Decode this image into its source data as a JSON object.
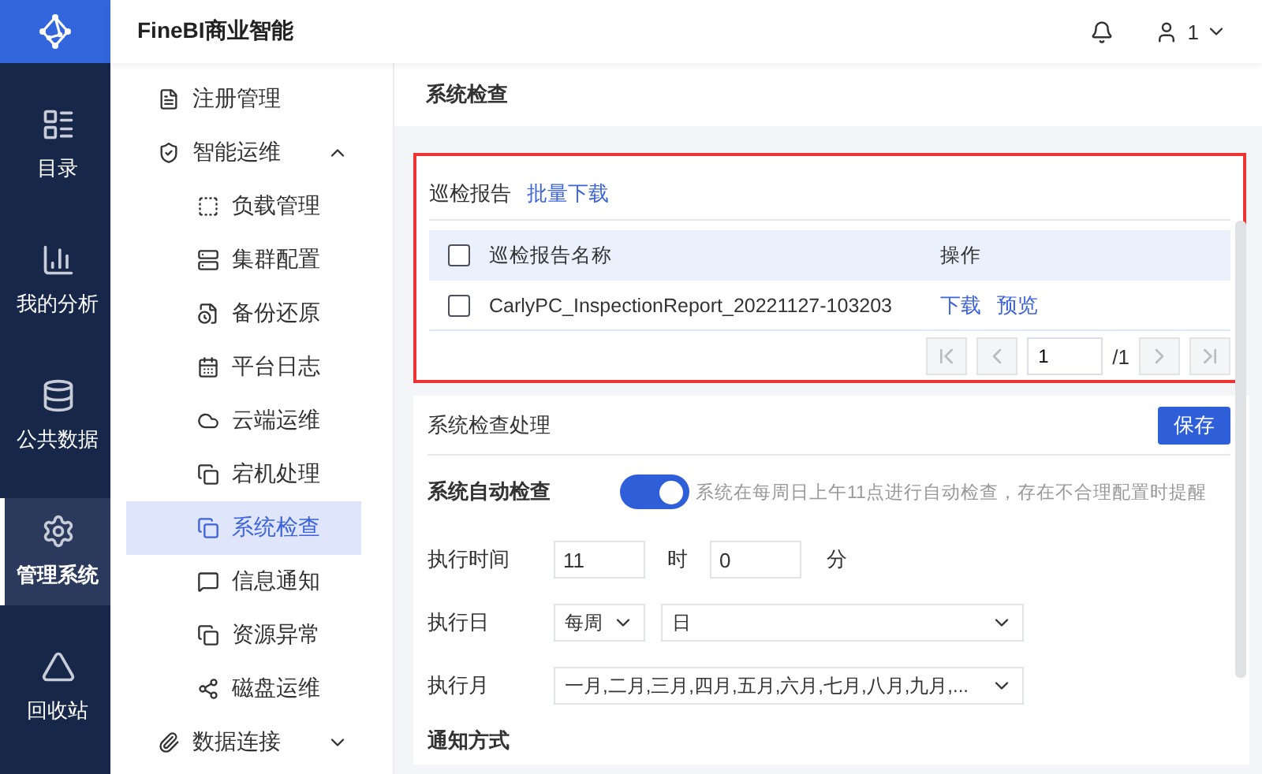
{
  "app": {
    "title": "FineBI商业智能"
  },
  "header": {
    "user": "1"
  },
  "nav": [
    {
      "label": "目录",
      "selected": false
    },
    {
      "label": "我的分析",
      "selected": false
    },
    {
      "label": "公共数据",
      "selected": false
    },
    {
      "label": "管理系统",
      "selected": true
    },
    {
      "label": "回收站",
      "selected": false
    }
  ],
  "sidebar": [
    {
      "label": "注册管理",
      "selected": false
    },
    {
      "label": "智能运维",
      "selected": false,
      "expanded": true,
      "children": [
        {
          "label": "负载管理",
          "selected": false
        },
        {
          "label": "集群配置",
          "selected": false
        },
        {
          "label": "备份还原",
          "selected": false
        },
        {
          "label": "平台日志",
          "selected": false
        },
        {
          "label": "云端运维",
          "selected": false
        },
        {
          "label": "宕机处理",
          "selected": false
        },
        {
          "label": "系统检查",
          "selected": true
        },
        {
          "label": "信息通知",
          "selected": false
        },
        {
          "label": "资源异常",
          "selected": false
        },
        {
          "label": "磁盘运维",
          "selected": false
        }
      ]
    },
    {
      "label": "数据连接",
      "selected": false,
      "expanded": false
    }
  ],
  "page_title": "系统检查",
  "reports": {
    "title": "巡检报告",
    "batch_link": "批量下载",
    "header_checked": false,
    "columns": [
      "巡检报告名称",
      "操作"
    ],
    "rows": [
      {
        "name": "CarlyPC_InspectionReport_20221127-103203",
        "checked": false,
        "actions": [
          "下载",
          "预览"
        ]
      }
    ],
    "pager": {
      "page": "1",
      "total": "/1"
    }
  },
  "processing": {
    "title": "系统检查处理",
    "save": "保存",
    "auto_check": {
      "label": "系统自动检查",
      "on": true,
      "hint": "系统在每周日上午11点进行自动检查，存在不合理配置时提醒"
    },
    "time": {
      "label": "执行时间",
      "hour": "11",
      "hour_unit": "时",
      "minute": "0",
      "minute_unit": "分"
    },
    "day": {
      "label": "执行日",
      "period": "每周",
      "day": "日"
    },
    "month": {
      "label": "执行月",
      "value": "一月,二月,三月,四月,五月,六月,七月,八月,九月,..."
    },
    "notify_label": "通知方式"
  }
}
